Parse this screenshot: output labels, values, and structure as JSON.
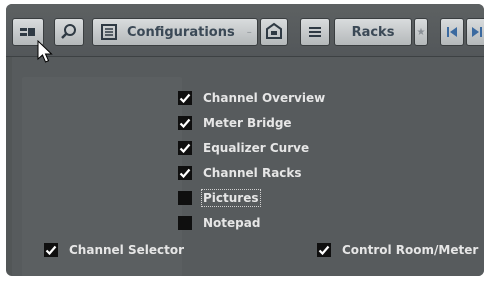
{
  "toolbar": {
    "configurations_label": "Configurations",
    "racks_label": "Racks",
    "star": "★",
    "dash": "–"
  },
  "options": [
    {
      "label": "Channel Overview",
      "checked": true
    },
    {
      "label": "Meter Bridge",
      "checked": true
    },
    {
      "label": "Equalizer Curve",
      "checked": true
    },
    {
      "label": "Channel Racks",
      "checked": true
    },
    {
      "label": "Pictures",
      "checked": false
    },
    {
      "label": "Notepad",
      "checked": false
    }
  ],
  "bottom_options": [
    {
      "label": "Channel Selector",
      "checked": true
    },
    {
      "label": "Control Room/Meter",
      "checked": true
    }
  ],
  "colors": {
    "toolbar_bg": "#575b5d",
    "button_text": "#3b4956",
    "label_text": "#e6e6e6",
    "checkbox_bg": "#0f0f0f"
  },
  "icons": {
    "window_layout": "window-layout-icon",
    "search": "magnifier-icon",
    "list": "list-icon",
    "config_store": "store-configuration-icon",
    "menu": "hamburger-menu-icon",
    "prev": "go-to-start-icon",
    "next": "go-to-next-icon",
    "cursor": "mouse-cursor-icon"
  }
}
